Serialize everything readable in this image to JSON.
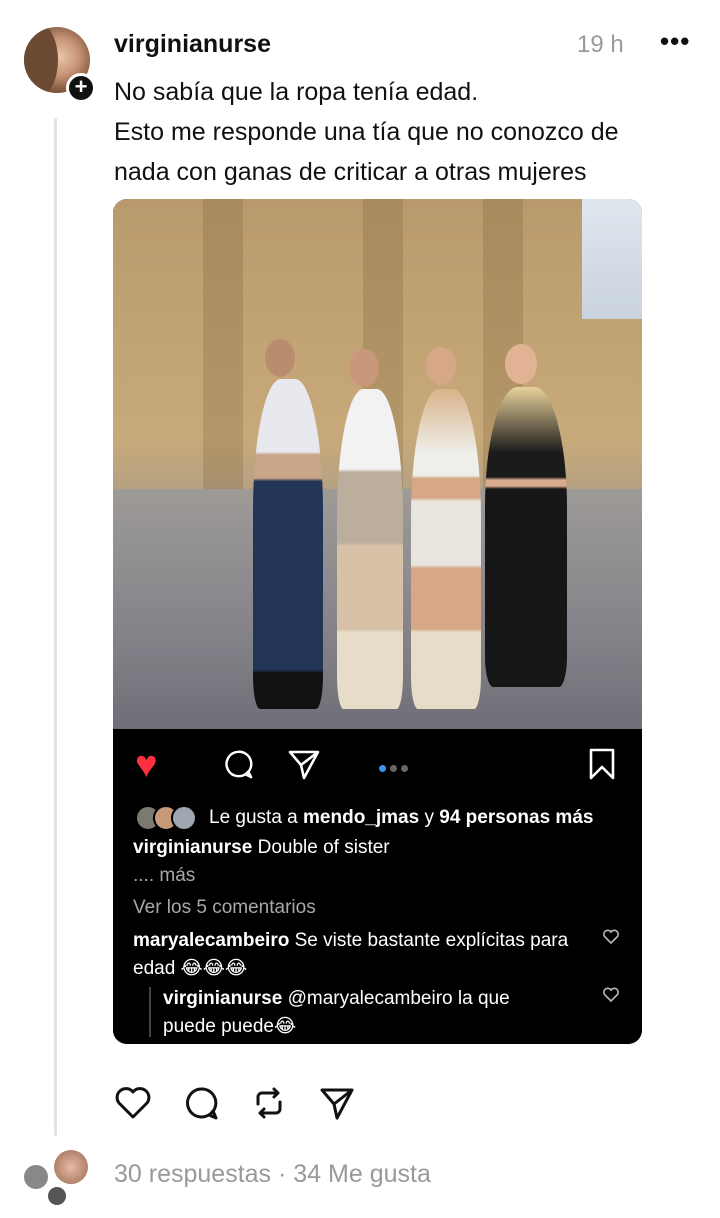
{
  "post": {
    "username": "virginianurse",
    "time": "19 h",
    "more": "•••",
    "text_lines": [
      "No sabía que la ropa tenía edad.",
      "Esto me responde una tía que no conozco de",
      "nada con ganas de criticar a otras mujeres"
    ],
    "follow_symbol": "+"
  },
  "embed": {
    "liked_heart": "♥",
    "likes_prefix": "Le gusta a ",
    "likes_user": "mendo_jmas",
    "likes_middle": " y ",
    "likes_count": "94 personas más",
    "caption_user": "virginianurse",
    "caption_text": "Double of sister",
    "more_text": ".... más",
    "view_comments": "Ver los 5 comentarios",
    "comment": {
      "user": "maryalecambeiro",
      "text": "Se viste bastante explícitas para edad 😂😂😂"
    },
    "reply": {
      "user": "virginianurse",
      "text": "@maryalecambeiro la que puede puede😂"
    },
    "carousel_pages": 3,
    "carousel_current": 1
  },
  "footer": {
    "stats": "30 respuestas · 34 Me gusta"
  },
  "icons": [
    "heart-icon",
    "comment-icon",
    "repost-icon",
    "share-icon",
    "bookmark-icon",
    "more-icon"
  ]
}
